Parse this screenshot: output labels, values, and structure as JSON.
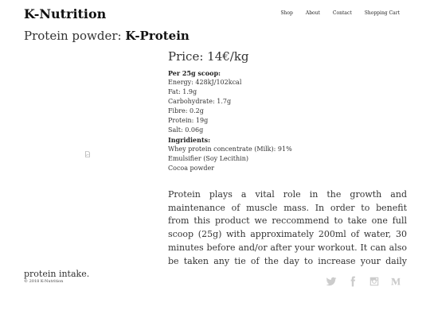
{
  "header": {
    "brand": "K-Nutrition",
    "nav": [
      "Shop",
      "About",
      "Contact",
      "Shopping Cart"
    ]
  },
  "title": {
    "prefix": "Protein powder: ",
    "product": "K-Protein"
  },
  "product": {
    "price": "Price: 14€/kg",
    "per_scoop_heading": "Per 25g scoop:",
    "nutrition": [
      "Energy: 428kJ/102kcal",
      "Fat: 1.9g",
      "Carbohydrate: 1.7g",
      "Fibre: 0.2g",
      "Protein: 19g",
      "Salt: 0.06g"
    ],
    "ingredients_heading": "Ingridients:",
    "ingredients": [
      "Whey protein concentrate (Milk): 91%",
      "Emulsifier (Soy Lecithin)",
      "Cocoa powder"
    ],
    "description": "Protein plays a vital role in the growth and maintenance of muscle mass. In order to benefit from this product we reccommend to take one full scoop (25g) with approximately 200ml of water, 30 minutes before and/or after your workout. It can also be taken any tie of the day to increase your daily protein intake."
  },
  "footer": {
    "copyright": "© 2018 K-Nutrition",
    "social_icons": [
      "twitter-icon",
      "facebook-icon",
      "instagram-icon",
      "medium-icon"
    ],
    "icon_color": "#cccccc"
  }
}
